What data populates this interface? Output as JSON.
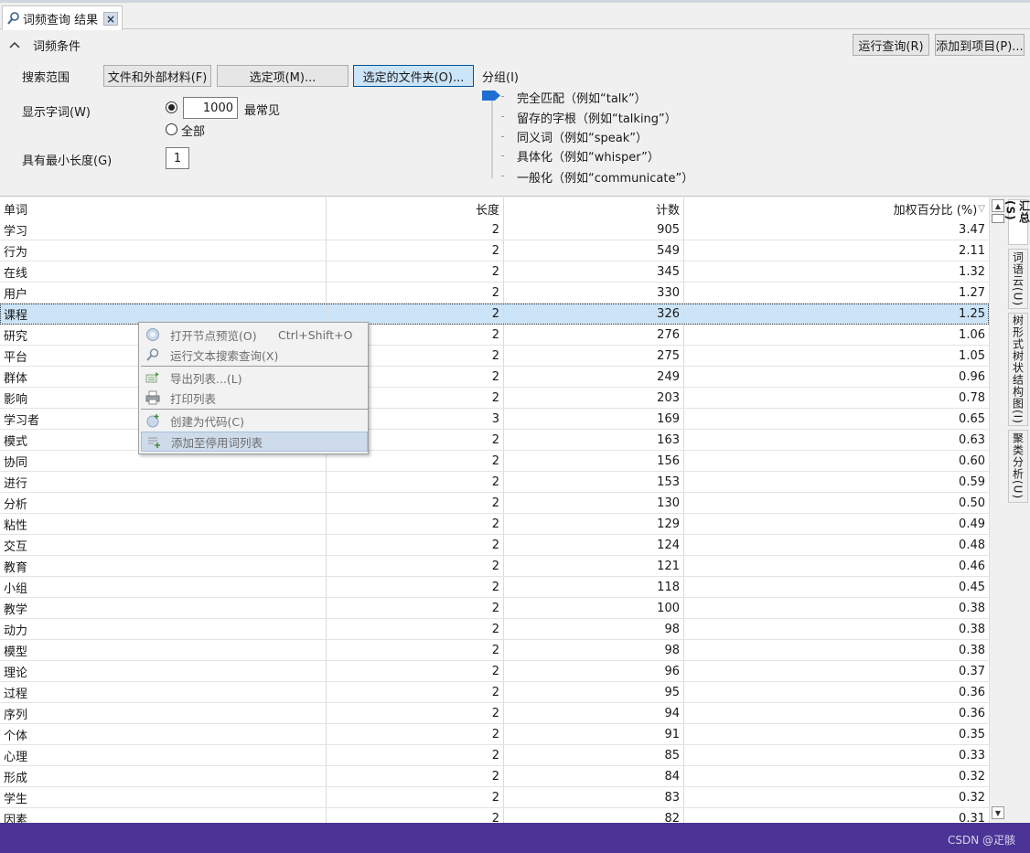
{
  "tab": {
    "title": "词频查询 结果",
    "close": "×"
  },
  "conditions": {
    "title": "词频条件",
    "run_query": "运行查询(R)",
    "add_to_project": "添加到项目(P)...",
    "scope_label": "搜索范围",
    "scope_files": "文件和外部材料(F)",
    "scope_selected": "选定项(M)...",
    "scope_folders": "选定的文件夹(O)...",
    "display_label": "显示字词(W)",
    "display_count": "1000",
    "most_frequent": "最常见",
    "all": "全部",
    "min_length_label": "具有最小长度(G)",
    "min_length": "1",
    "grouping_label": "分组(I)",
    "grouping_options": [
      "完全匹配（例如“talk”）",
      "留存的字根（例如“talking”）",
      "同义词（例如“speak”）",
      "具体化（例如“whisper”）",
      "一般化（例如“communicate”）"
    ]
  },
  "table": {
    "headers": [
      "单词",
      "长度",
      "计数",
      "加权百分比 (%)"
    ],
    "sort_indicator": "▽",
    "rows": [
      [
        "学习",
        "2",
        "905",
        "3.47"
      ],
      [
        "行为",
        "2",
        "549",
        "2.11"
      ],
      [
        "在线",
        "2",
        "345",
        "1.32"
      ],
      [
        "用户",
        "2",
        "330",
        "1.27"
      ],
      [
        "课程",
        "2",
        "326",
        "1.25"
      ],
      [
        "研究",
        "2",
        "276",
        "1.06"
      ],
      [
        "平台",
        "2",
        "275",
        "1.05"
      ],
      [
        "群体",
        "2",
        "249",
        "0.96"
      ],
      [
        "影响",
        "2",
        "203",
        "0.78"
      ],
      [
        "学习者",
        "3",
        "169",
        "0.65"
      ],
      [
        "模式",
        "2",
        "163",
        "0.63"
      ],
      [
        "协同",
        "2",
        "156",
        "0.60"
      ],
      [
        "进行",
        "2",
        "153",
        "0.59"
      ],
      [
        "分析",
        "2",
        "130",
        "0.50"
      ],
      [
        "粘性",
        "2",
        "129",
        "0.49"
      ],
      [
        "交互",
        "2",
        "124",
        "0.48"
      ],
      [
        "教育",
        "2",
        "121",
        "0.46"
      ],
      [
        "小组",
        "2",
        "118",
        "0.45"
      ],
      [
        "教学",
        "2",
        "100",
        "0.38"
      ],
      [
        "动力",
        "2",
        "98",
        "0.38"
      ],
      [
        "模型",
        "2",
        "98",
        "0.38"
      ],
      [
        "理论",
        "2",
        "96",
        "0.37"
      ],
      [
        "过程",
        "2",
        "95",
        "0.36"
      ],
      [
        "序列",
        "2",
        "94",
        "0.36"
      ],
      [
        "个体",
        "2",
        "91",
        "0.35"
      ],
      [
        "心理",
        "2",
        "85",
        "0.33"
      ],
      [
        "形成",
        "2",
        "84",
        "0.32"
      ],
      [
        "学生",
        "2",
        "83",
        "0.32"
      ],
      [
        "因素",
        "2",
        "82",
        "0.31"
      ]
    ],
    "selected_index": 4
  },
  "side_tabs": [
    "汇总(S)",
    "词语云(U)",
    "树形式树状结构图(I)",
    "聚类分析(U)"
  ],
  "context_menu": {
    "items": [
      {
        "label": "打开节点预览(O)",
        "shortcut": "Ctrl+Shift+O",
        "icon": "node-preview-icon"
      },
      {
        "label": "运行文本搜索查询(X)",
        "shortcut": "",
        "icon": "text-search-icon"
      },
      {
        "label": "导出列表...(L)",
        "shortcut": "",
        "icon": "export-list-icon"
      },
      {
        "label": "打印列表",
        "shortcut": "",
        "icon": "print-icon"
      },
      {
        "label": "创建为代码(C)",
        "shortcut": "",
        "icon": "create-code-icon"
      },
      {
        "label": "添加至停用词列表",
        "shortcut": "",
        "icon": "stopword-list-icon"
      }
    ]
  },
  "watermark": "CSDN @疋骸",
  "colors": {
    "status_bar": "#4b3495",
    "selection": "#cce4f7",
    "menu_highlight": "#cddbea"
  }
}
